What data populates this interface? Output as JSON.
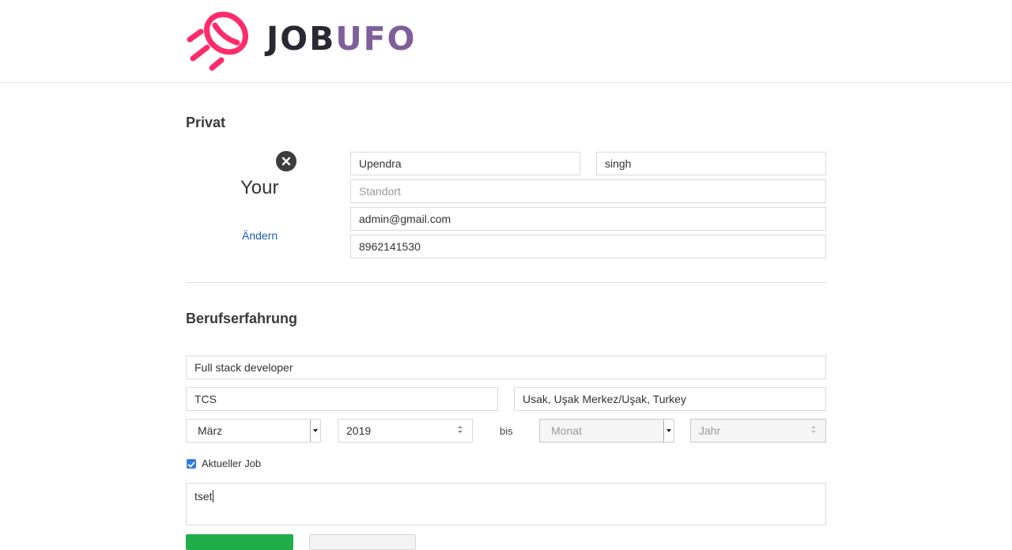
{
  "header": {
    "logo_text_job": "JOB",
    "logo_text_ufo": "UFO",
    "brand_colors": {
      "mark": "#ff2b6a",
      "job": "#2b2834",
      "ufo": "#7e5f9a"
    }
  },
  "privat": {
    "title": "Privat",
    "avatar_text": "Your",
    "change_link": "Ändern",
    "first_name": "Upendra",
    "last_name": "singh",
    "location_placeholder": "Standort",
    "email": "admin@gmail.com",
    "phone": "8962141530"
  },
  "experience": {
    "title": "Berufserfahrung",
    "job_title": "Full stack developer",
    "company": "TCS",
    "location": "Usak, Uşak Merkez/Uşak, Turkey",
    "start_month": "März",
    "start_year": "2019",
    "to_label": "bis",
    "end_month_placeholder": "Monat",
    "end_year_placeholder": "Jahr",
    "current_job_label": "Aktueller Job",
    "current_job_checked": true,
    "description": "tset"
  }
}
